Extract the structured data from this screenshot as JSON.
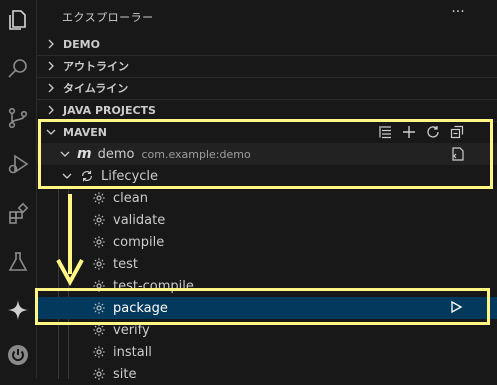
{
  "activity_bar": {
    "icons": [
      "explorer-icon",
      "search-icon",
      "source-control-icon",
      "run-debug-icon",
      "extensions-icon",
      "testing-icon",
      "copilot-icon",
      "spring-boot-icon"
    ]
  },
  "explorer": {
    "title": "エクスプローラー",
    "more": "···"
  },
  "sections": {
    "demo": "DEMO",
    "outline": "アウトライン",
    "timeline": "タイムライン",
    "java_projects": "JAVA PROJECTS",
    "maven": "MAVEN"
  },
  "maven": {
    "project_name": "demo",
    "project_id": "com.example:demo",
    "lifecycle_label": "Lifecycle",
    "phases": [
      "clean",
      "validate",
      "compile",
      "test",
      "test-compile",
      "package",
      "verify",
      "install",
      "site"
    ],
    "selected_phase": "package"
  },
  "colors": {
    "highlight": "#fff684",
    "selection": "#04395e",
    "background": "#181818"
  }
}
